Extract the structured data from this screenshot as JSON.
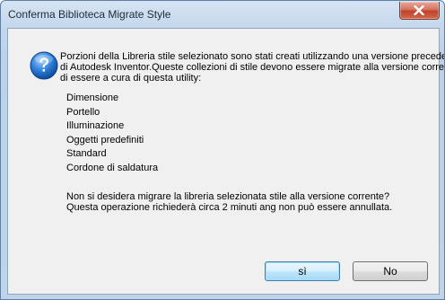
{
  "window": {
    "title": "Conferma Biblioteca Migrate Style"
  },
  "message": {
    "line1": "Porzioni della Libreria stile selezionato sono stati creati utilizzando una versione precedente",
    "line2": "di Autodesk Inventor.Queste collezioni di stile devono essere migrate alla versione corrente",
    "line3": "di essere a cura di questa utility:"
  },
  "collections": [
    "Dimensione",
    "Portello",
    "Illuminazione",
    "Oggetti predefiniti",
    "Standard",
    "Cordone di saldatura"
  ],
  "question": {
    "line1": "Non si desidera migrare la libreria selezionata stile alla versione corrente?",
    "line2": "Questa operazione richiederà circa 2 minuti ang non può essere annullata."
  },
  "buttons": {
    "yes": "sì",
    "no": "No"
  },
  "icons": {
    "dialog": "question-icon",
    "close": "close-icon"
  },
  "colors": {
    "title_bar": "#c4d7ec",
    "close_button": "#c2412a",
    "client_background": "#f0f0f0",
    "question_icon": "#1f64b8"
  }
}
